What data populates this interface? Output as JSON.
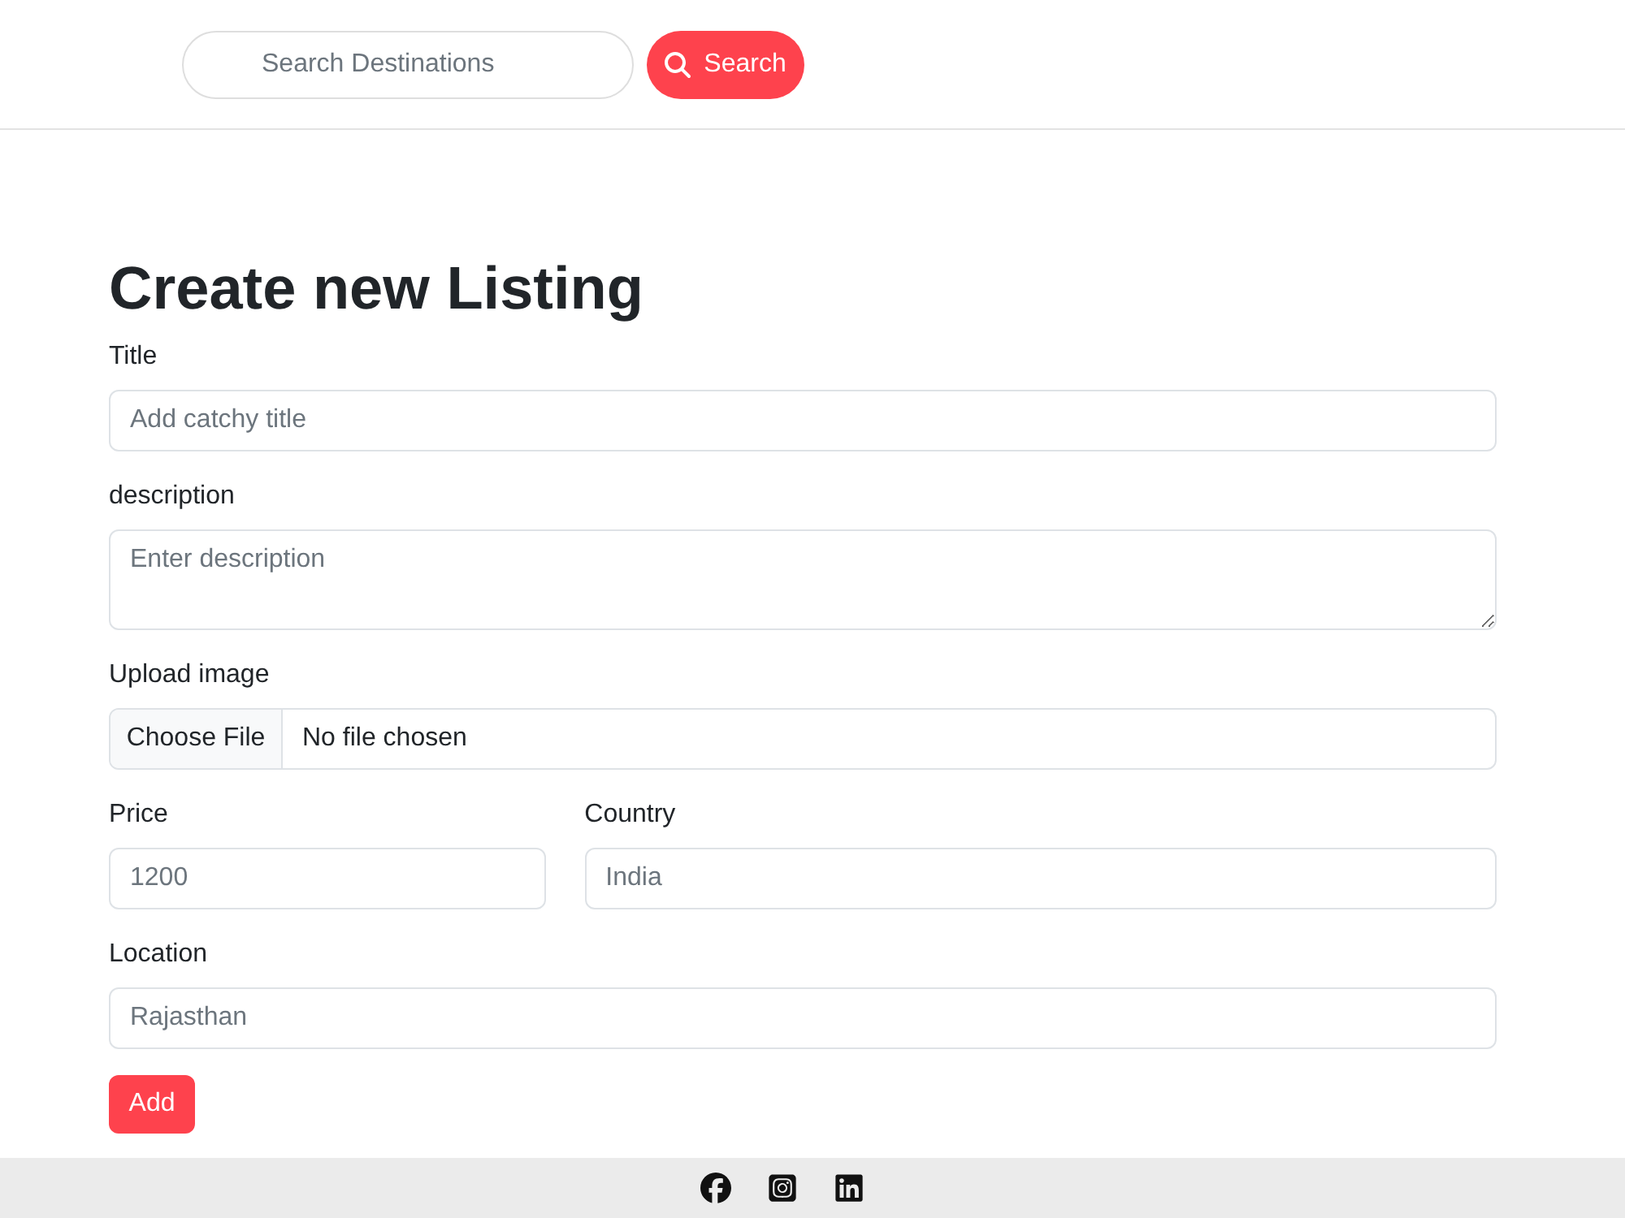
{
  "navbar": {
    "search": {
      "placeholder": "Search Destinations"
    },
    "search_button": "Search"
  },
  "form": {
    "heading": "Create new Listing",
    "rows": [
      [
        {
          "kind": "text",
          "label": "Title",
          "placeholder": "Add catchy title"
        }
      ],
      [
        {
          "kind": "textarea",
          "label": "description",
          "placeholder": "Enter description"
        }
      ],
      [
        {
          "kind": "file",
          "label": "Upload image",
          "button": "Choose File",
          "status": "No file chosen"
        }
      ],
      [
        {
          "kind": "text",
          "label": "Price",
          "placeholder": "1200"
        },
        {
          "kind": "text",
          "label": "Country",
          "placeholder": "India"
        }
      ],
      [
        {
          "kind": "text",
          "label": "Location",
          "placeholder": "Rajasthan"
        }
      ]
    ],
    "submit": "Add"
  }
}
